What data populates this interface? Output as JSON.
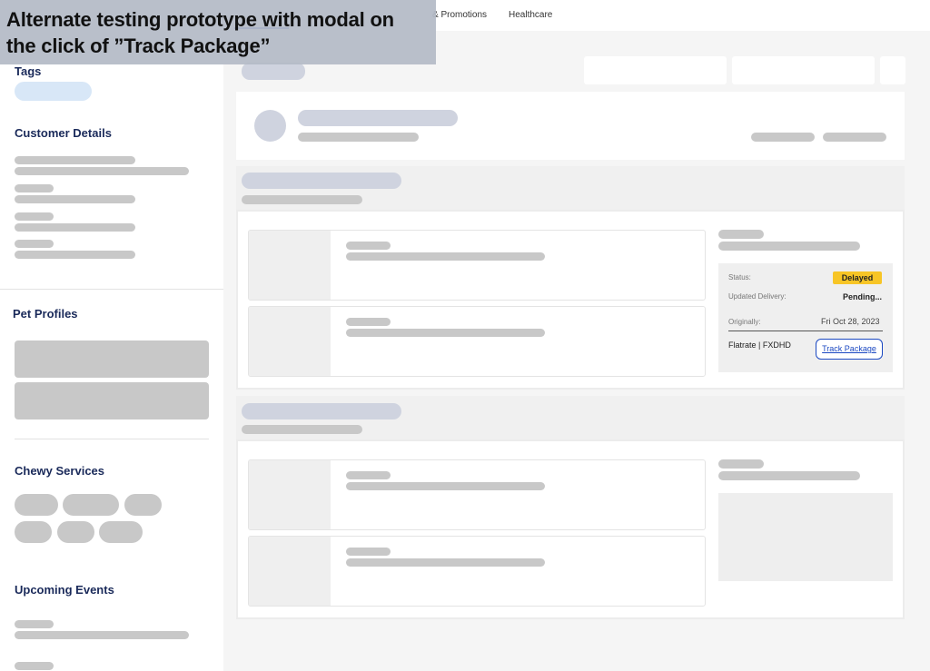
{
  "banner": {
    "line1": "Alternate testing prototype with modal on",
    "line2": "the click of ”Track Package”"
  },
  "topnav": {
    "items": [
      "& Promotions",
      "Healthcare"
    ]
  },
  "sidebar": {
    "tags_heading": "Tags",
    "customer_heading": "Customer Details",
    "pets_heading": "Pet Profiles",
    "services_heading": "Chewy Services",
    "events_heading": "Upcoming Events"
  },
  "order_status": {
    "status_label": "Status:",
    "status_value": "Delayed",
    "updated_label": "Updated Delivery:",
    "updated_value": "Pending...",
    "original_label": "Originally:",
    "original_value": "Fri Oct 28, 2023",
    "carrier": "Flatrate |  FXDHD",
    "track_label": "Track Package"
  },
  "colors": {
    "accent": "#1c49c2",
    "heading": "#1a2a5a",
    "status_delayed": "#f7c526"
  }
}
